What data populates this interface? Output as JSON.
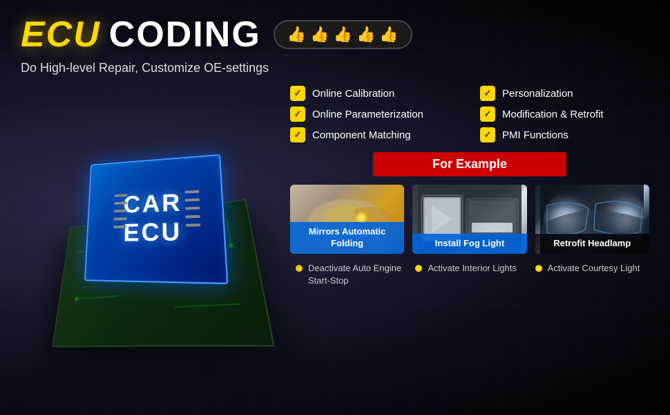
{
  "header": {
    "title_ecu": "ECU",
    "title_coding": "CODING",
    "subtitle": "Do High-level Repair, Customize OE-settings",
    "thumbs": [
      "👍",
      "👍",
      "👍",
      "👍",
      "👍"
    ]
  },
  "features": [
    {
      "id": 1,
      "label": "Online Calibration"
    },
    {
      "id": 2,
      "label": "Personalization"
    },
    {
      "id": 3,
      "label": "Online Parameterization"
    },
    {
      "id": 4,
      "label": "Modification & Retrofit"
    },
    {
      "id": 5,
      "label": "Component Matching"
    },
    {
      "id": 6,
      "label": "PMI Functions"
    }
  ],
  "example_banner": "For Example",
  "cards": [
    {
      "id": "mirrors",
      "label": "Mirrors Automatic Folding",
      "label_style": "blue"
    },
    {
      "id": "foglight",
      "label": "Install Fog Light",
      "label_style": "blue"
    },
    {
      "id": "headlamp",
      "label": "Retrofit Headlamp",
      "label_style": "dark"
    }
  ],
  "bullets": [
    {
      "id": "b1",
      "text": "Deactivate Auto Engine Start-Stop"
    },
    {
      "id": "b2",
      "text": "Activate Interior Lights"
    },
    {
      "id": "b3",
      "text": "Activate Courtesy Light"
    }
  ],
  "chip": {
    "line1": "CAR",
    "line2": "ECU"
  }
}
